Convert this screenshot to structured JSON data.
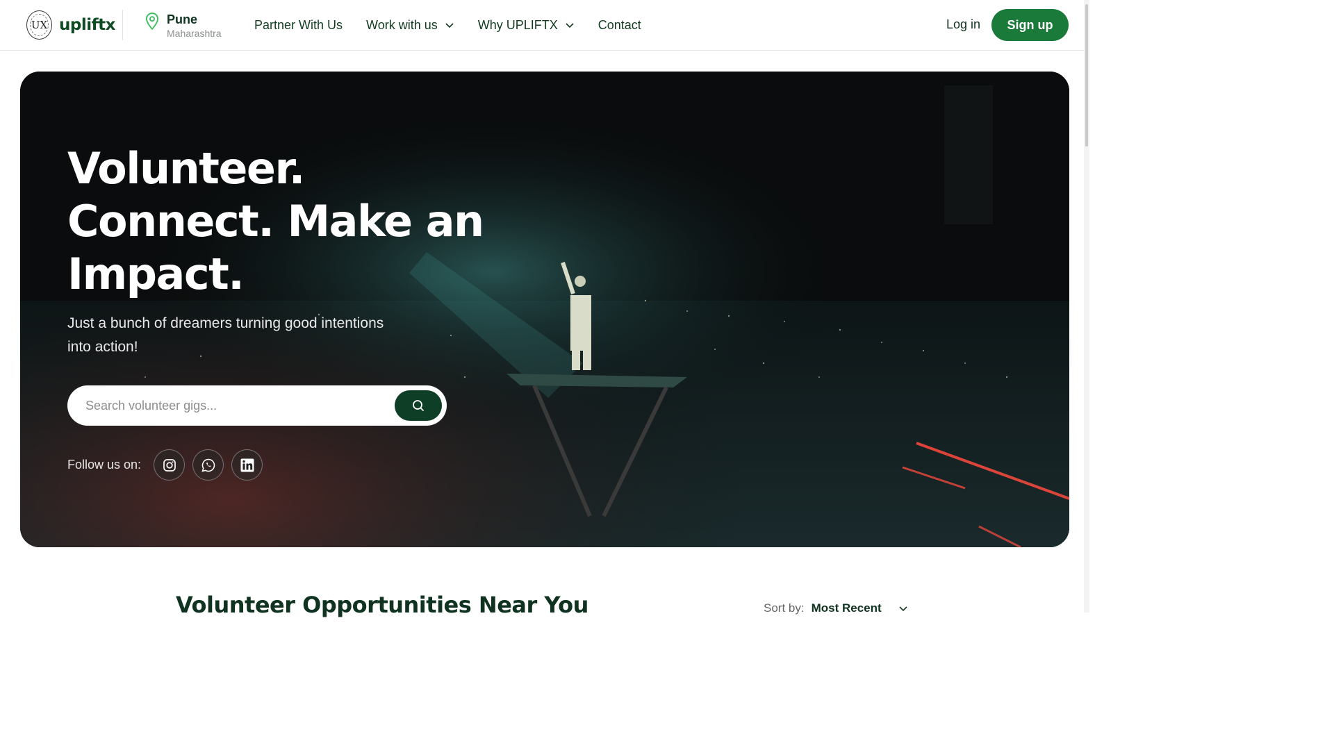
{
  "brand": {
    "name": "upliftx",
    "badge_text": "UX"
  },
  "location": {
    "city": "Pune",
    "state": "Maharashtra"
  },
  "nav": {
    "items": [
      {
        "label": "Partner With Us",
        "has_dropdown": false
      },
      {
        "label": "Work with us",
        "has_dropdown": true
      },
      {
        "label": "Why UPLIFTX",
        "has_dropdown": true
      },
      {
        "label": "Contact",
        "has_dropdown": false
      }
    ]
  },
  "auth": {
    "login_label": "Log in",
    "signup_label": "Sign up"
  },
  "hero": {
    "title": "Volunteer. Connect. Make an Impact.",
    "subtitle": "Just a bunch of dreamers turning good intentions into action!",
    "search_placeholder": "Search volunteer gigs...",
    "follow_label": "Follow us on:",
    "social": [
      "instagram-icon",
      "whatsapp-icon",
      "linkedin-icon"
    ]
  },
  "listing": {
    "title": "Volunteer Opportunities Near You",
    "sort_label": "Sort by:",
    "sort_value": "Most Recent"
  },
  "colors": {
    "brand_green": "#1a7a3a",
    "dark_green": "#0e3e25",
    "text_green": "#123b22",
    "hero_bg": "#0a0c0d"
  }
}
